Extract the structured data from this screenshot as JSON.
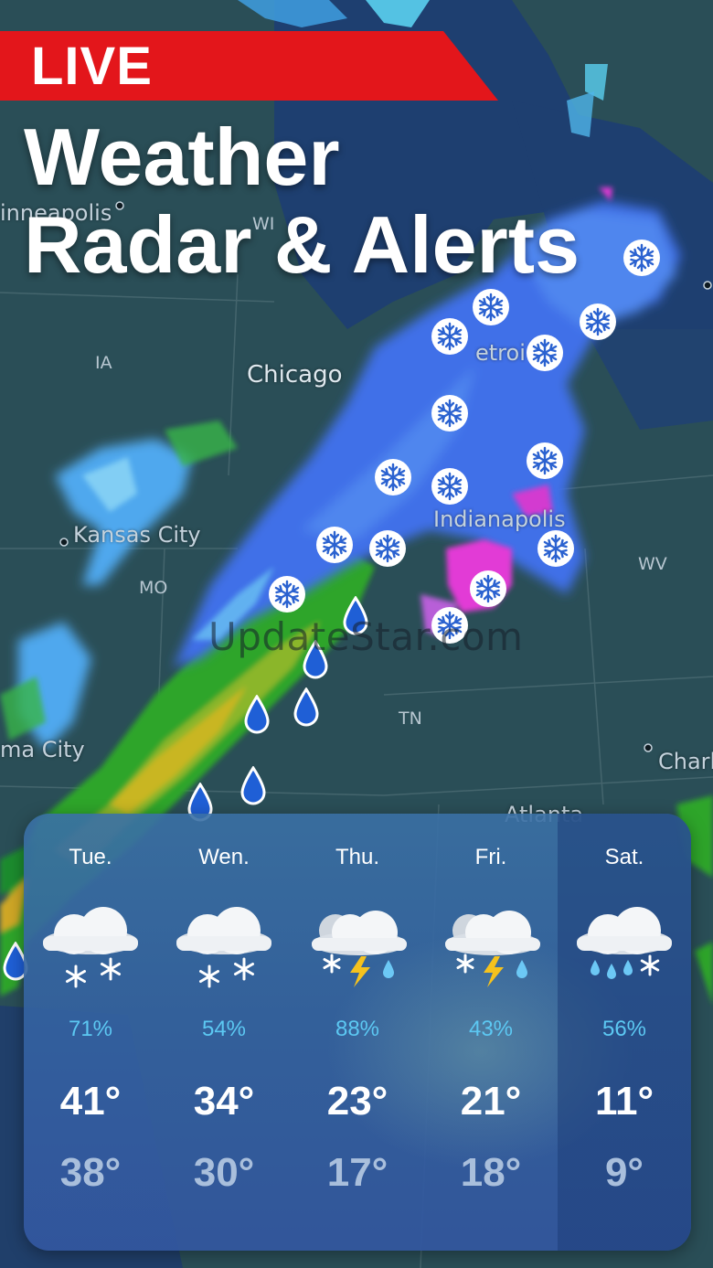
{
  "banner": {
    "live_label": "LIVE"
  },
  "headline": {
    "line1": "Weather",
    "line2": "Radar & Alerts"
  },
  "map": {
    "cities": [
      {
        "name": "Minneapolis",
        "display": "inneapolis"
      },
      {
        "name": "Chicago",
        "display": "Chicago"
      },
      {
        "name": "Kansas City",
        "display": "Kansas City"
      },
      {
        "name": "Indianapolis",
        "display": "Indianapolis"
      },
      {
        "name": "Detroit",
        "display": "etroi"
      },
      {
        "name": "Oklahoma City",
        "display": "ma City"
      },
      {
        "name": "Charlotte",
        "display": "Charl"
      },
      {
        "name": "Atlanta",
        "display": "Atlanta"
      }
    ],
    "states": [
      "IA",
      "WI",
      "MO",
      "TN",
      "WV"
    ],
    "watermark": "UpdateStar.com"
  },
  "forecast": {
    "days": [
      {
        "name": "Tue.",
        "icon": "cloud-snow-icon",
        "precip": "71%",
        "high": "41°",
        "low": "38°",
        "selected": false
      },
      {
        "name": "Wen.",
        "icon": "cloud-snow-icon",
        "precip": "54%",
        "high": "34°",
        "low": "30°",
        "selected": false
      },
      {
        "name": "Thu.",
        "icon": "cloud-thunder-snow-rain-icon",
        "precip": "88%",
        "high": "23°",
        "low": "17°",
        "selected": false
      },
      {
        "name": "Fri.",
        "icon": "cloud-thunder-snow-rain-icon",
        "precip": "43%",
        "high": "21°",
        "low": "18°",
        "selected": false
      },
      {
        "name": "Sat.",
        "icon": "cloud-rain-snow-icon",
        "precip": "56%",
        "high": "11°",
        "low": "9°",
        "selected": true
      }
    ]
  },
  "colors": {
    "live_red": "#e3161b",
    "precip_blue": "#5cc8f2",
    "snow_blue": "#3f6fe8",
    "rain_blue": "#1f5fd6",
    "mix_magenta": "#e23ad6"
  }
}
